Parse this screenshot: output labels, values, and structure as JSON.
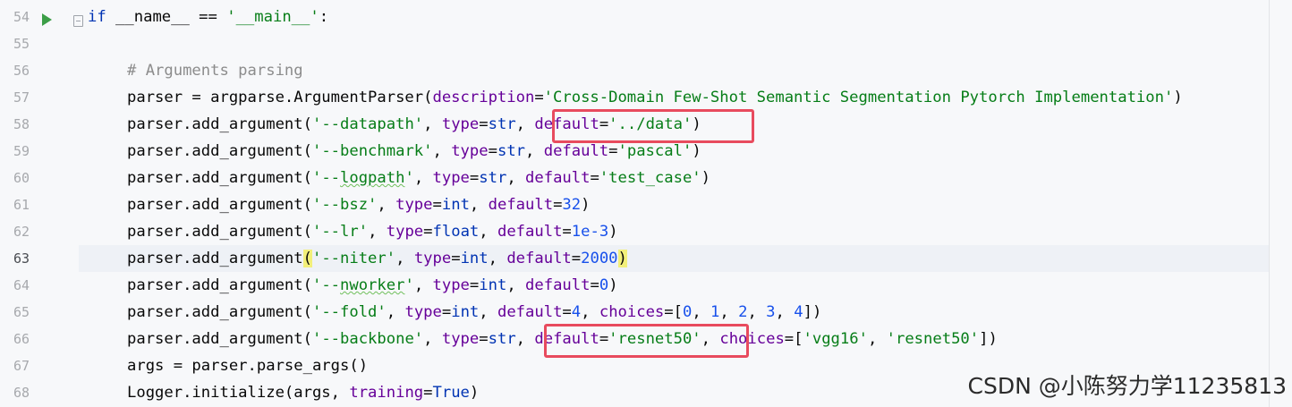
{
  "gutter": {
    "line_numbers": [
      "54",
      "55",
      "56",
      "57",
      "58",
      "59",
      "60",
      "61",
      "62",
      "63",
      "64",
      "65",
      "66",
      "67",
      "68"
    ],
    "run_icon": "run-triangle-icon",
    "fold_icon": "fold-marker-icon"
  },
  "code": {
    "l54": {
      "kw": "if",
      "t1": " __name__ == ",
      "s1": "'__main__'",
      "t2": ":"
    },
    "l56": {
      "comment": "# Arguments parsing"
    },
    "l57": {
      "t1": "parser = argparse.ArgumentParser(",
      "p1": "description",
      "t2": "=",
      "s1": "'Cross-Domain Few-Shot Semantic Segmentation Pytorch Implementation'",
      "t3": ")"
    },
    "l58": {
      "t1": "parser.add_argument(",
      "s1": "'--datapath'",
      "t2": ", ",
      "p1": "type",
      "t3": "=",
      "b1": "str",
      "t4": ", ",
      "p2": "default",
      "t5": "=",
      "s2": "'../data'",
      "t6": ")"
    },
    "l59": {
      "t1": "parser.add_argument(",
      "s1": "'--benchmark'",
      "t2": ", ",
      "p1": "type",
      "t3": "=",
      "b1": "str",
      "t4": ", ",
      "p2": "default",
      "t5": "=",
      "s2": "'pascal'",
      "t6": ")"
    },
    "l60": {
      "t1": "parser.add_argument(",
      "s1a": "'--",
      "s1b": "logpath",
      "s1c": "'",
      "t2": ", ",
      "p1": "type",
      "t3": "=",
      "b1": "str",
      "t4": ", ",
      "p2": "default",
      "t5": "=",
      "s2": "'test_case'",
      "t6": ")"
    },
    "l61": {
      "t1": "parser.add_argument(",
      "s1": "'--bsz'",
      "t2": ", ",
      "p1": "type",
      "t3": "=",
      "b1": "int",
      "t4": ", ",
      "p2": "default",
      "t5": "=",
      "n1": "32",
      "t6": ")"
    },
    "l62": {
      "t1": "parser.add_argument(",
      "s1": "'--lr'",
      "t2": ", ",
      "p1": "type",
      "t3": "=",
      "b1": "float",
      "t4": ", ",
      "p2": "default",
      "t5": "=",
      "n1": "1e-3",
      "t6": ")"
    },
    "l63": {
      "t1": "parser.add_argument",
      "br1": "(",
      "s1": "'--niter'",
      "t2": ", ",
      "p1": "type",
      "t3": "=",
      "b1": "int",
      "t4": ", ",
      "p2": "default",
      "t5": "=",
      "n1": "2000",
      "br2": ")"
    },
    "l64": {
      "t1": "parser.add_argument(",
      "s1a": "'--",
      "s1b": "nworker",
      "s1c": "'",
      "t2": ", ",
      "p1": "type",
      "t3": "=",
      "b1": "int",
      "t4": ", ",
      "p2": "default",
      "t5": "=",
      "n1": "0",
      "t6": ")"
    },
    "l65": {
      "t1": "parser.add_argument(",
      "s1": "'--fold'",
      "t2": ", ",
      "p1": "type",
      "t3": "=",
      "b1": "int",
      "t4": ", ",
      "p2": "default",
      "t5": "=",
      "n1": "4",
      "t6": ", ",
      "p3": "choices",
      "t7": "=[",
      "n2": "0",
      "t8": ", ",
      "n3": "1",
      "t9": ", ",
      "n4": "2",
      "t10": ", ",
      "n5": "3",
      "t11": ", ",
      "n6": "4",
      "t12": "])"
    },
    "l66": {
      "t1": "parser.add_argument(",
      "s1": "'--backbone'",
      "t2": ", ",
      "p1": "type",
      "t3": "=",
      "b1": "str",
      "t4": ", ",
      "p2": "default",
      "t5": "=",
      "s2": "'resnet50'",
      "t6": ", ",
      "p3": "choices",
      "t7": "=[",
      "s3": "'vgg16'",
      "t8": ", ",
      "s4": "'resnet50'",
      "t9": "])"
    },
    "l67": {
      "t1": "args = parser.parse_args()"
    },
    "l68": {
      "t1": "Logger.initialize(args, ",
      "p1": "training",
      "t2": "=",
      "k1": "True",
      "t3": ")"
    }
  },
  "watermark": "CSDN @小陈努力学11235813",
  "colors": {
    "keyword": "#0033b3",
    "string": "#067d17",
    "comment": "#8c8c8c",
    "param": "#660099",
    "number": "#1750eb",
    "highlight_box": "#e84b5e",
    "run_icon": "#3c9e47"
  }
}
